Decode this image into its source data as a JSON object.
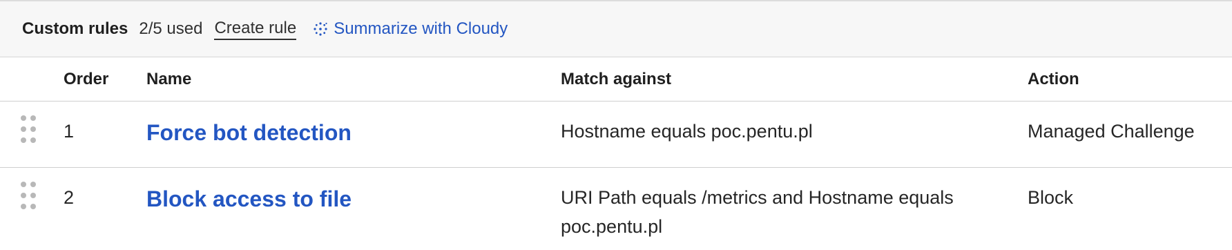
{
  "toolbar": {
    "title": "Custom rules",
    "usage": "2/5 used",
    "create_label": "Create rule",
    "summarize_label": "Summarize with Cloudy",
    "summarize_icon": "sparkle-icon"
  },
  "table": {
    "columns": {
      "order": "Order",
      "name": "Name",
      "match": "Match against",
      "action": "Action"
    },
    "rows": [
      {
        "order": "1",
        "name": "Force bot detection",
        "match": "Hostname equals poc.pentu.pl",
        "action": "Managed Challenge"
      },
      {
        "order": "2",
        "name": "Block access to file",
        "match": "URI Path equals /metrics and Hostname equals poc.pentu.pl",
        "action": "Block"
      }
    ]
  },
  "colors": {
    "link": "#2356c2",
    "toolbar_bg": "#f7f7f7",
    "handle": "#b8b8b8"
  }
}
